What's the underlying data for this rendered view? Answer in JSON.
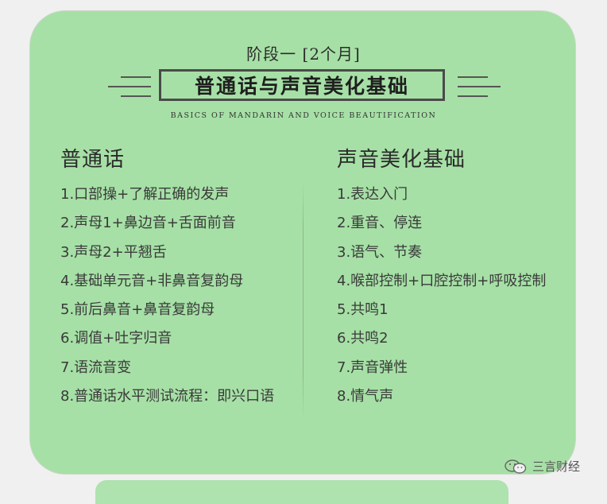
{
  "stage": "阶段一 [2个月]",
  "title": "普通话与声音美化基础",
  "subtitle": "BASICS OF MANDARIN AND VOICE BEAUTIFICATION",
  "left_column": {
    "heading": "普通话",
    "items": [
      "1.口部操+了解正确的发声",
      "2.声母1+鼻边音+舌面前音",
      "3.声母2+平翘舌",
      "4.基础单元音+非鼻音复韵母",
      "5.前后鼻音+鼻音复韵母",
      "6.调值+吐字归音",
      "7.语流音变",
      "8.普通话水平测试流程：即兴口语"
    ]
  },
  "right_column": {
    "heading": "声音美化基础",
    "items": [
      "1.表达入门",
      "2.重音、停连",
      "3.语气、节奏",
      "4.喉部控制+口腔控制+呼吸控制",
      "5.共鸣1",
      "6.共鸣2",
      "7.声音弹性",
      "8.情气声"
    ]
  },
  "watermark": {
    "icon": "wechat-icon",
    "text": "三言财经"
  },
  "colors": {
    "card": "#a6e0a6",
    "page_bg": "#f0f0f0",
    "text": "#3a3a3a"
  }
}
